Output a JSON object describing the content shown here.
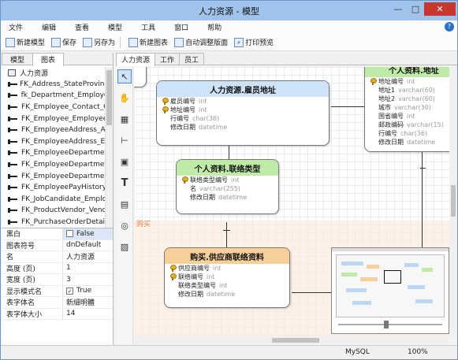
{
  "window": {
    "title": "人力资源 - 模型",
    "controls": [
      "—",
      "□",
      "✕"
    ]
  },
  "menu": [
    "文件",
    "编辑",
    "查看",
    "模型",
    "工具",
    "窗口",
    "帮助"
  ],
  "toolbar": [
    {
      "label": "新建模型",
      "icon": "new-model-icon"
    },
    {
      "label": "保存",
      "icon": "save-icon"
    },
    {
      "label": "另存为",
      "icon": "save-as-icon"
    },
    {
      "label": "新建图表",
      "icon": "new-diagram-icon"
    },
    {
      "label": "自动调整版面",
      "icon": "auto-layout-icon"
    },
    {
      "label": "打印预览",
      "icon": "print-preview-icon"
    }
  ],
  "left_tabs": [
    "模型",
    "图表"
  ],
  "objects": [
    "人力资源",
    "FK_Address_StateProvince",
    "fk_Department_Employee",
    "FK_Employee_Contact_C",
    "FK_Employee_Employee",
    "FK_EmployeeAddress_A",
    "FK_EmployeeAddress_E",
    "FK_EmployeeDepartment",
    "FK_EmployeeDepartment",
    "FK_EmployeeDepartment",
    "FK_EmployeePayHistory",
    "FK_JobCandidate_Emplo",
    "FK_ProductVendor_Vend",
    "FK_PurchaseOrderDetai"
  ],
  "properties": [
    {
      "key": "黑白",
      "value": "False",
      "checkbox": true,
      "checked": false
    },
    {
      "key": "图表符号",
      "value": "dnDefault"
    },
    {
      "key": "名",
      "value": "人力资源"
    },
    {
      "key": "高度 (页)",
      "value": "1"
    },
    {
      "key": "宽度 (页)",
      "value": "3"
    },
    {
      "key": "显示模式名",
      "value": "True",
      "checkbox": true,
      "checked": true
    },
    {
      "key": "表字体名",
      "value": "新細明體"
    },
    {
      "key": "表字体大小",
      "value": "14"
    }
  ],
  "diagram_tabs": [
    "人力资源",
    "工作",
    "员工"
  ],
  "layer_label": "购买",
  "entities": {
    "address": {
      "title": "人力资源.雇员地址",
      "fields": [
        {
          "name": "雇员编号",
          "type": "int",
          "key": true
        },
        {
          "name": "地址编号",
          "type": "int",
          "key": true
        },
        {
          "name": "行编号",
          "type": "char(36)"
        },
        {
          "name": "修改日期",
          "type": "datetime"
        }
      ]
    },
    "contact_type": {
      "title": "个人资料.联络类型",
      "fields": [
        {
          "name": "联络类型编号",
          "type": "int",
          "key": true
        },
        {
          "name": "名",
          "type": "varchar(255)"
        },
        {
          "name": "修改日期",
          "type": "datetime"
        }
      ]
    },
    "vendor_contact": {
      "title": "购买.供应商联络资料",
      "fields": [
        {
          "name": "供应商编号",
          "type": "int",
          "key": true
        },
        {
          "name": "联络编号",
          "type": "int",
          "key": true
        },
        {
          "name": "联络类型编号",
          "type": "int"
        },
        {
          "name": "修改日期",
          "type": "datetime"
        }
      ]
    },
    "person_address": {
      "title": "个人资料.地址",
      "fields": [
        {
          "name": "地址编号",
          "type": "int",
          "key": true
        },
        {
          "name": "地址1",
          "type": "varchar(60)"
        },
        {
          "name": "地址2",
          "type": "varchar(60)"
        },
        {
          "name": "城市",
          "type": "varchar(30)"
        },
        {
          "name": "国省编号",
          "type": "int"
        },
        {
          "name": "邮政编码",
          "type": "varchar(15)"
        },
        {
          "name": "行编号",
          "type": "char(36)"
        },
        {
          "name": "修改日期",
          "type": "datetime"
        }
      ]
    }
  },
  "status": {
    "db": "MySQL",
    "zoom": "100%"
  },
  "colors": {
    "title_bar": "#9fc3ea",
    "blue_header": "#cfe3f8",
    "green_header": "#bfeaa8",
    "orange_header": "#f6cf9a",
    "layer": "#faebdc"
  }
}
